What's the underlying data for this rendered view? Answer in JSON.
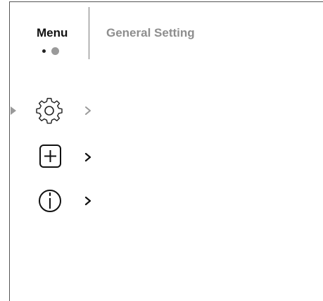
{
  "header": {
    "menu_label": "Menu",
    "page_indicator": {
      "current": 2,
      "total": 2
    },
    "section_title": "General Setting"
  },
  "menu": {
    "selected_index": 0,
    "items": [
      {
        "icon": "gear-icon",
        "state": "selected"
      },
      {
        "icon": "add-box-icon",
        "state": "normal"
      },
      {
        "icon": "info-circle-icon",
        "state": "normal"
      }
    ]
  },
  "colors": {
    "text_primary": "#111111",
    "text_muted": "#8e8e8e",
    "accent_gray": "#9a9a9a",
    "background": "#ffffff"
  }
}
